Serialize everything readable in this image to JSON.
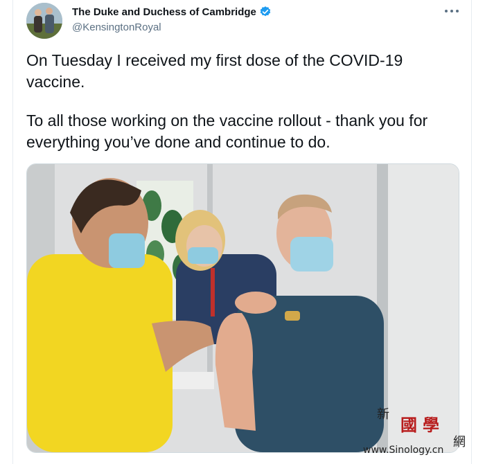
{
  "tweet": {
    "display_name": "The Duke and Duchess of Cambridge",
    "handle": "@KensingtonRoyal",
    "verified": true,
    "more_icon": "more-horizontal-icon",
    "paragraphs": [
      "On Tuesday I received my first dose of the COVID-19 vaccine.",
      "To all those working on the vaccine rollout - thank you for everything you’ve done and continue to do."
    ]
  },
  "watermark": {
    "char_1": "新",
    "char_2": "國學",
    "char_3": "網",
    "url": "www.Sinology.cn"
  },
  "colors": {
    "text": "#0f1419",
    "secondary": "#5b7083",
    "verified": "#1d9bf0",
    "border": "#cfd9de"
  }
}
